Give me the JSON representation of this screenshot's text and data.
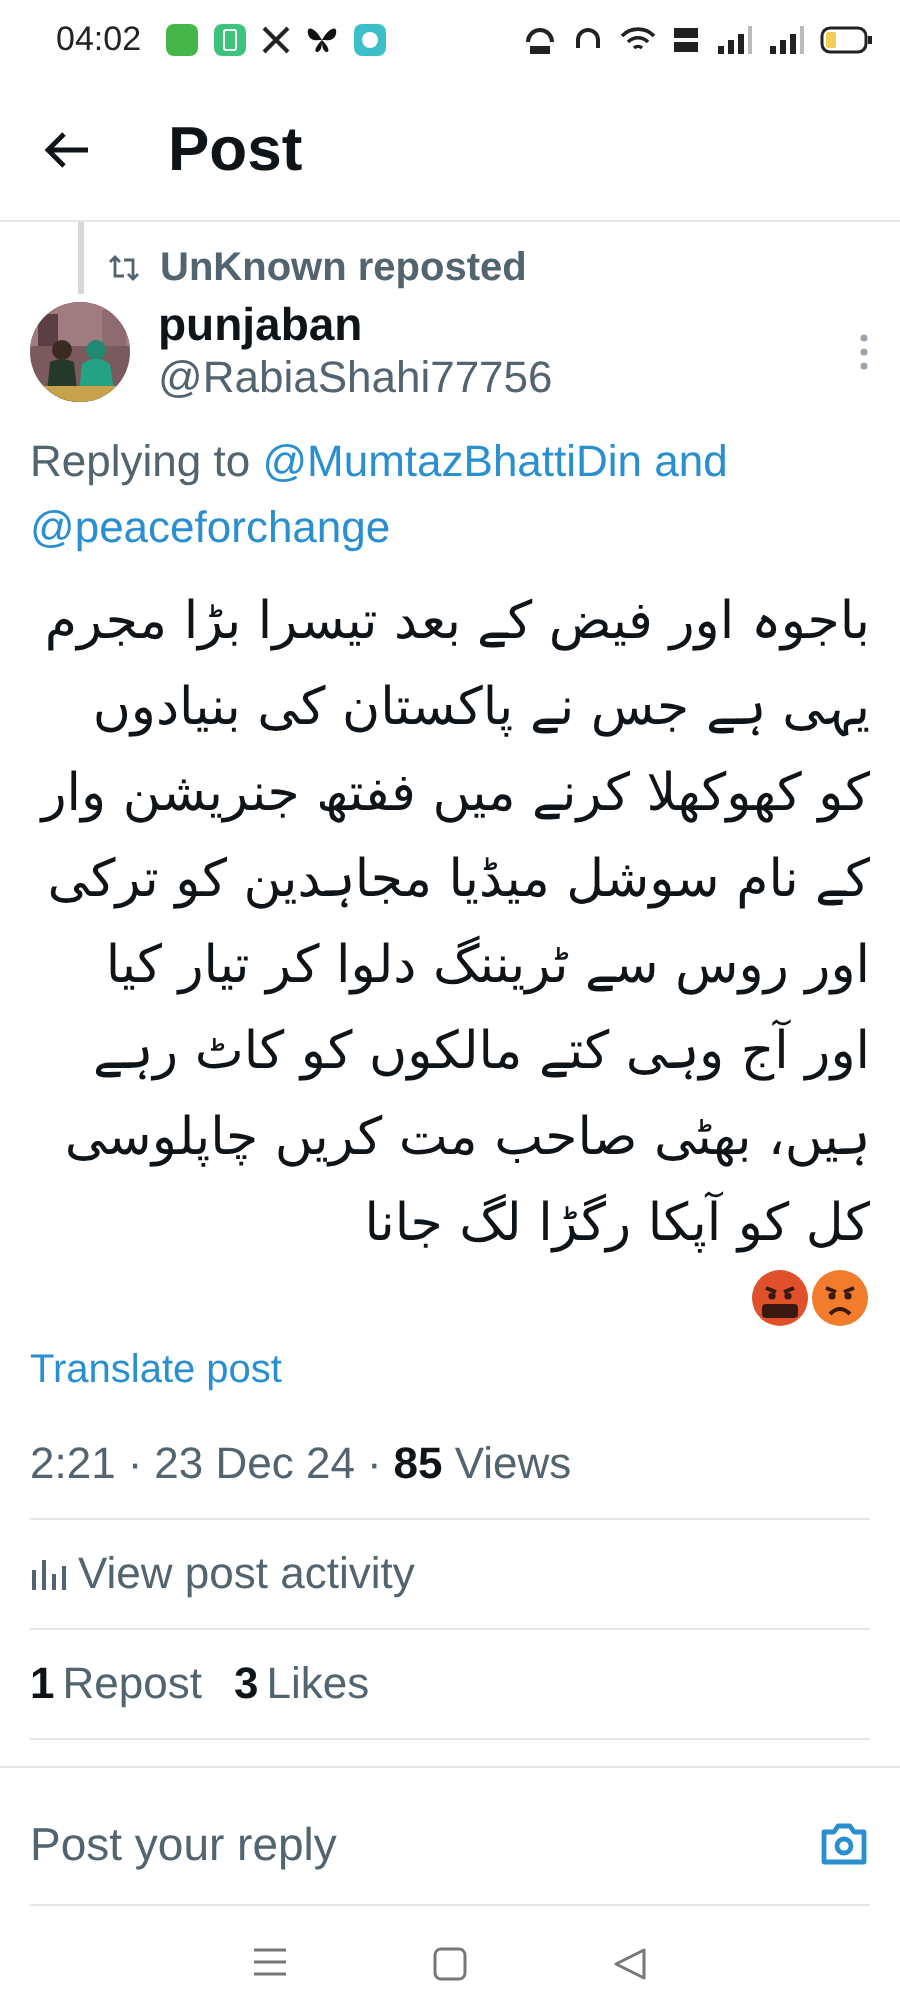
{
  "status_bar": {
    "time": "04:02"
  },
  "header": {
    "title": "Post"
  },
  "post": {
    "reposted_by": "UnKnown reposted",
    "author": {
      "name": "punjaban",
      "handle": "@RabiaShahi77756"
    },
    "replying_label": "Replying to",
    "replying_to": [
      "@MumtazBhattiDin",
      "@peaceforchange"
    ],
    "replying_joiner": "and",
    "text": "باجوہ اور فیض کے بعد تیسرا بڑا مجرم یہی ہے جس نے پاکستان کی بنیادوں کو کھوکھلا کرنے میں ففتھ جنریشن وار کے نام سوشل میڈیا مجاہدین کو ترکی اور روس سے ٹریننگ دلوا کر تیار کیا اور آج وہی کتے مالکوں کو کاٹ رہے ہیں، بھٹی صاحب مت کریں چاپلوسی کل کو آپکا رگڑا لگ جانا",
    "translate": "Translate post",
    "time": "2:21",
    "separator": "·",
    "date": "23 Dec 24",
    "views_count": "85",
    "views_label": "Views",
    "activity": "View post activity",
    "reposts": {
      "count": "1",
      "label": "Repost"
    },
    "likes": {
      "count": "3",
      "label": "Likes"
    }
  },
  "reply": {
    "placeholder": "Post your reply"
  }
}
